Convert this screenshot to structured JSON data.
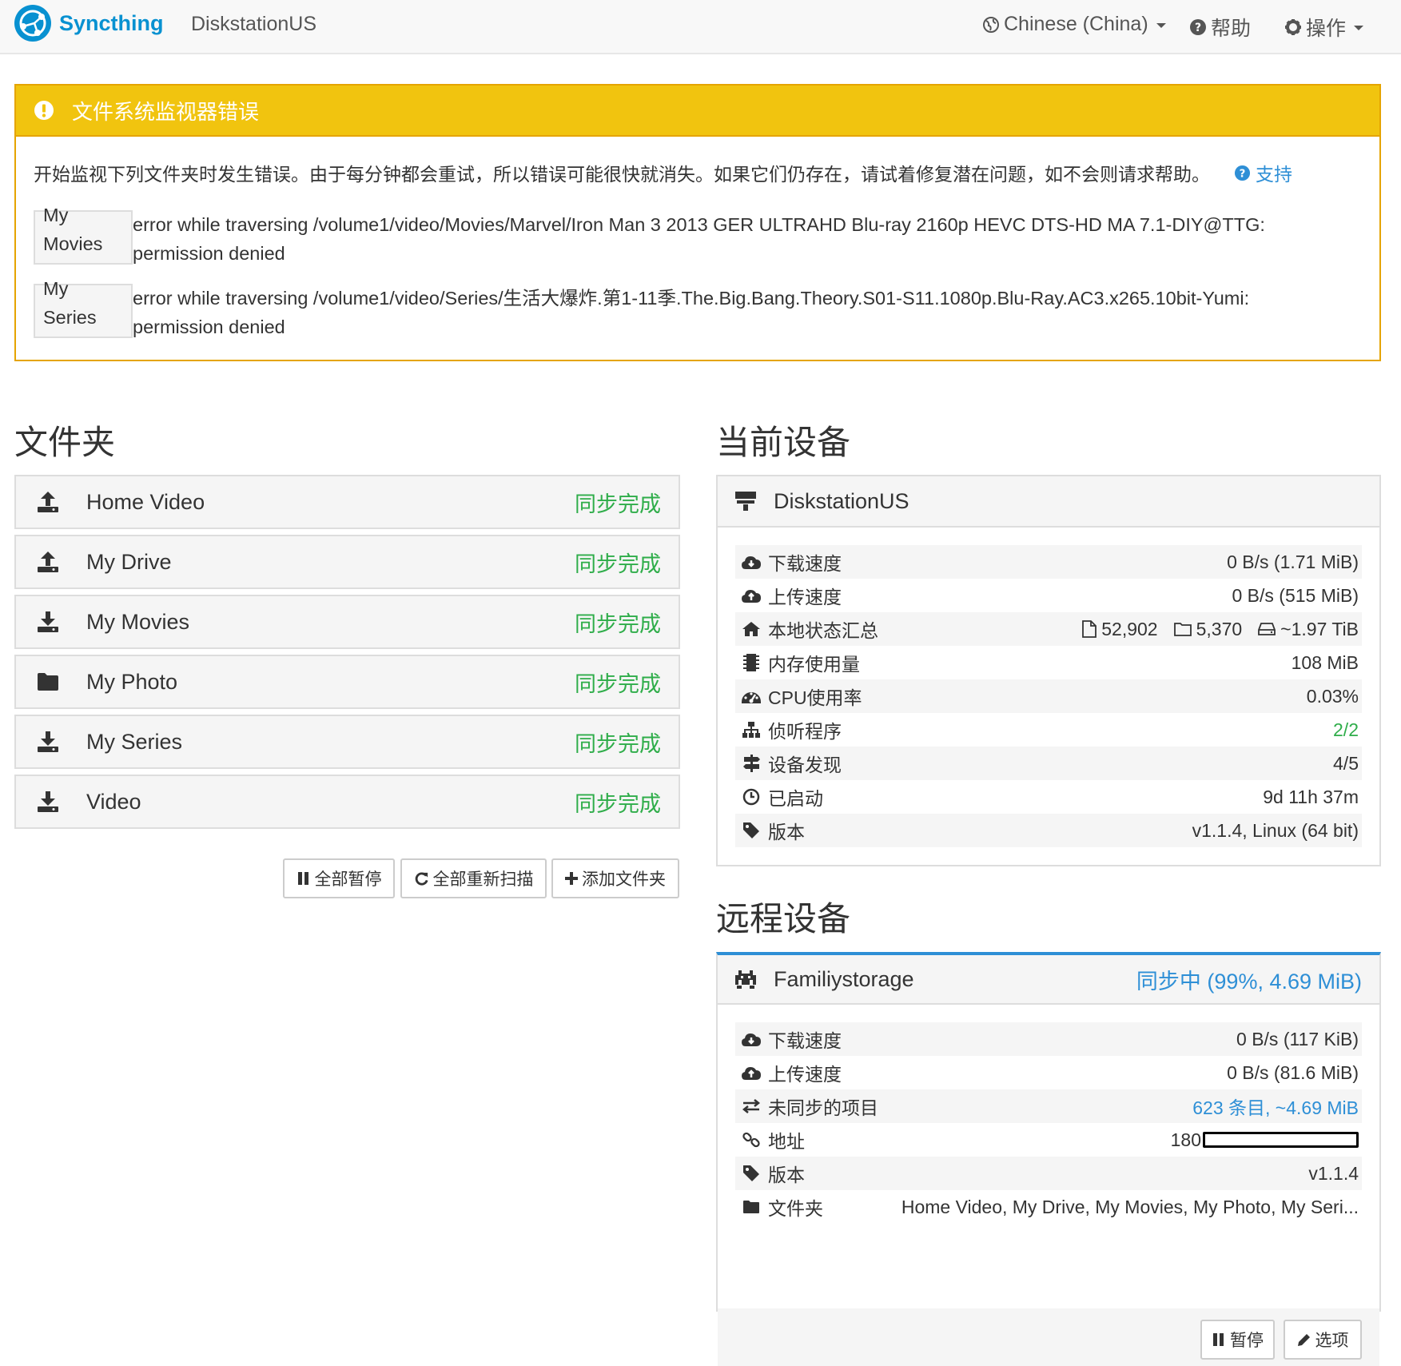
{
  "navbar": {
    "brand": "Syncthing",
    "device_name": "DiskstationUS",
    "language": "Chinese (China)",
    "help": "帮助",
    "actions": "操作"
  },
  "alert": {
    "title": "文件系统监视器错误",
    "message": "开始监视下列文件夹时发生错误。由于每分钟都会重试，所以错误可能很快就消失。如果它们仍存在，请试着修复潜在问题，如不会则请求帮助。",
    "support_link": "支持",
    "errors": [
      {
        "folder": "My Movies",
        "text": "error while traversing /volume1/video/Movies/Marvel/Iron Man 3 2013 GER ULTRAHD Blu-ray 2160p HEVC DTS-HD MA 7.1-DIY@TTG: permission denied"
      },
      {
        "folder": "My Series",
        "text": "error while traversing /volume1/video/Series/生活大爆炸.第1-11季.The.Big.Bang.Theory.S01-S11.1080p.Blu-Ray.AC3.x265.10bit-Yumi: permission denied"
      }
    ]
  },
  "folders_section": {
    "heading": "文件夹",
    "folders": [
      {
        "name": "Home Video",
        "status": "同步完成",
        "icon": "upload-icon"
      },
      {
        "name": "My Drive",
        "status": "同步完成",
        "icon": "upload-icon"
      },
      {
        "name": "My Movies",
        "status": "同步完成",
        "icon": "download-icon"
      },
      {
        "name": "My Photo",
        "status": "同步完成",
        "icon": "folder-icon"
      },
      {
        "name": "My Series",
        "status": "同步完成",
        "icon": "download-icon"
      },
      {
        "name": "Video",
        "status": "同步完成",
        "icon": "download-icon"
      }
    ],
    "buttons": {
      "pause_all": "全部暂停",
      "rescan_all": "全部重新扫描",
      "add_folder": "添加文件夹"
    }
  },
  "this_device": {
    "heading": "当前设备",
    "name": "DiskstationUS",
    "stats": {
      "download_label": "下载速度",
      "download_value": "0 B/s (1.71 MiB)",
      "upload_label": "上传速度",
      "upload_value": "0 B/s (515 MiB)",
      "local_state_label": "本地状态汇总",
      "files": "52,902",
      "dirs": "5,370",
      "size": "~1.97 TiB",
      "ram_label": "内存使用量",
      "ram_value": "108 MiB",
      "cpu_label": "CPU使用率",
      "cpu_value": "0.03%",
      "listeners_label": "侦听程序",
      "listeners_value": "2/2",
      "discovery_label": "设备发现",
      "discovery_value": "4/5",
      "uptime_label": "已启动",
      "uptime_value": "9d 11h 37m",
      "version_label": "版本",
      "version_value": "v1.1.4, Linux (64 bit)"
    }
  },
  "remote_devices": {
    "heading": "远程设备",
    "device": {
      "name": "Familiystorage",
      "status": "同步中 (99%, 4.69 MiB)",
      "download_label": "下载速度",
      "download_value": "0 B/s (117 KiB)",
      "upload_label": "上传速度",
      "upload_value": "0 B/s (81.6 MiB)",
      "out_of_sync_label": "未同步的项目",
      "out_of_sync_value": "623 条目, ~4.69 MiB",
      "address_label": "地址",
      "address_value": "180",
      "version_label": "版本",
      "version_value": "v1.1.4",
      "folders_label": "文件夹",
      "folders_value": "Home Video, My Drive, My Movies, My Photo, My Seri...",
      "pause_button": "暂停",
      "options_button": "选项"
    }
  },
  "colors": {
    "brand": "#0891d1",
    "warning": "#f1c40f",
    "success": "#2fad4a",
    "info": "#2e8fd6"
  }
}
